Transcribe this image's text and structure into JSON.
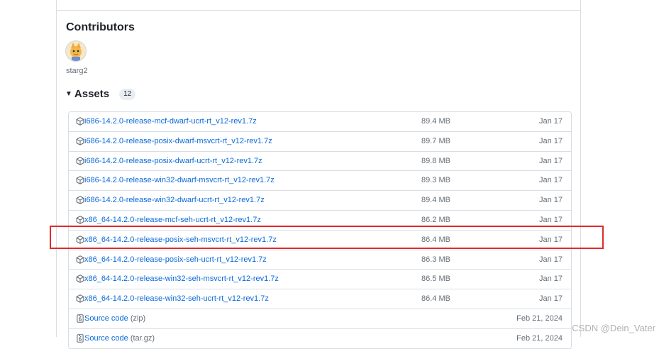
{
  "contributors": {
    "title": "Contributors",
    "name": "starg2"
  },
  "assets": {
    "title": "Assets",
    "count": "12",
    "items": [
      {
        "name": "i686-14.2.0-release-mcf-dwarf-ucrt-rt_v12-rev1.7z",
        "suffix": "",
        "size": "89.4 MB",
        "date": "Jan 17",
        "icon": "package-icon"
      },
      {
        "name": "i686-14.2.0-release-posix-dwarf-msvcrt-rt_v12-rev1.7z",
        "suffix": "",
        "size": "89.7 MB",
        "date": "Jan 17",
        "icon": "package-icon"
      },
      {
        "name": "i686-14.2.0-release-posix-dwarf-ucrt-rt_v12-rev1.7z",
        "suffix": "",
        "size": "89.8 MB",
        "date": "Jan 17",
        "icon": "package-icon"
      },
      {
        "name": "i686-14.2.0-release-win32-dwarf-msvcrt-rt_v12-rev1.7z",
        "suffix": "",
        "size": "89.3 MB",
        "date": "Jan 17",
        "icon": "package-icon"
      },
      {
        "name": "i686-14.2.0-release-win32-dwarf-ucrt-rt_v12-rev1.7z",
        "suffix": "",
        "size": "89.4 MB",
        "date": "Jan 17",
        "icon": "package-icon"
      },
      {
        "name": "x86_64-14.2.0-release-mcf-seh-ucrt-rt_v12-rev1.7z",
        "suffix": "",
        "size": "86.2 MB",
        "date": "Jan 17",
        "icon": "package-icon"
      },
      {
        "name": "x86_64-14.2.0-release-posix-seh-msvcrt-rt_v12-rev1.7z",
        "suffix": "",
        "size": "86.4 MB",
        "date": "Jan 17",
        "icon": "package-icon"
      },
      {
        "name": "x86_64-14.2.0-release-posix-seh-ucrt-rt_v12-rev1.7z",
        "suffix": "",
        "size": "86.3 MB",
        "date": "Jan 17",
        "icon": "package-icon"
      },
      {
        "name": "x86_64-14.2.0-release-win32-seh-msvcrt-rt_v12-rev1.7z",
        "suffix": "",
        "size": "86.5 MB",
        "date": "Jan 17",
        "icon": "package-icon"
      },
      {
        "name": "x86_64-14.2.0-release-win32-seh-ucrt-rt_v12-rev1.7z",
        "suffix": "",
        "size": "86.4 MB",
        "date": "Jan 17",
        "icon": "package-icon"
      },
      {
        "name": "Source code",
        "suffix": " (zip)",
        "size": "",
        "date": "Feb 21, 2024",
        "icon": "file-zip-icon"
      },
      {
        "name": "Source code",
        "suffix": " (tar.gz)",
        "size": "",
        "date": "Feb 21, 2024",
        "icon": "file-zip-icon"
      }
    ]
  },
  "watermark": "CSDN @Dein_Vater",
  "colors": {
    "link": "#0969da",
    "muted": "#656d76",
    "highlight": "#e02a2a"
  }
}
